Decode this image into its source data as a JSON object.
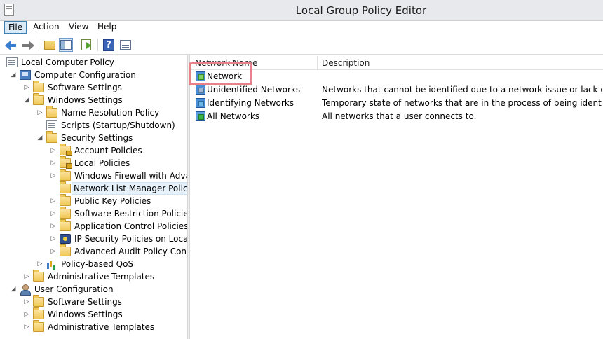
{
  "window": {
    "title": "Local Group Policy Editor"
  },
  "menu": {
    "file": "File",
    "action": "Action",
    "view": "View",
    "help": "Help"
  },
  "toolbar": {
    "buttons": [
      "back-arrow-icon",
      "forward-arrow-icon",
      "up-folder-icon",
      "show-hide-tree-icon",
      "export-list-icon",
      "help-icon",
      "properties-icon"
    ]
  },
  "tree": {
    "root": "Local Computer Policy",
    "computer_config": "Computer Configuration",
    "cc_software": "Software Settings",
    "cc_windows": "Windows Settings",
    "name_resolution": "Name Resolution Policy",
    "scripts": "Scripts (Startup/Shutdown)",
    "security": "Security Settings",
    "account": "Account Policies",
    "local": "Local Policies",
    "firewall": "Windows Firewall with Advanced Security",
    "netlist": "Network List Manager Policies",
    "pubkey": "Public Key Policies",
    "software_restriction": "Software Restriction Policies",
    "app_control": "Application Control Policies",
    "ipsec": "IP Security Policies on Local Computer",
    "audit": "Advanced Audit Policy Configuration",
    "qos": "Policy-based QoS",
    "cc_admin": "Administrative Templates",
    "user_config": "User Configuration",
    "uc_software": "Software Settings",
    "uc_windows": "Windows Settings",
    "uc_admin": "Administrative Templates"
  },
  "list": {
    "columns": {
      "name": "Network Name",
      "description": "Description"
    },
    "rows": [
      {
        "name": "Network",
        "description": ""
      },
      {
        "name": "Unidentified Networks",
        "description": "Networks that cannot be identified due to a network issue or lack of ide..."
      },
      {
        "name": "Identifying Networks",
        "description": "Temporary state of networks that are in the process of being identified."
      },
      {
        "name": "All Networks",
        "description": "All networks that a user connects to."
      }
    ]
  },
  "colors": {
    "highlight": "#e8828a",
    "selection": "#e5f1fb",
    "accent": "#3a7ed1"
  }
}
